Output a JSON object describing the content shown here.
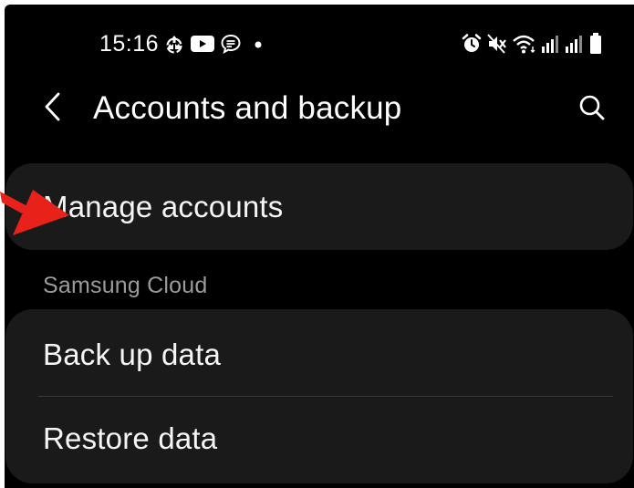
{
  "status_bar": {
    "time": "15:16",
    "left_icons": [
      "sync-icon",
      "youtube-icon",
      "message-icon",
      "dot-icon"
    ],
    "right_icons": [
      "alarm-icon",
      "mute-icon",
      "wifi-icon",
      "signal-icon",
      "signal-icon",
      "battery-icon"
    ]
  },
  "header": {
    "title": "Accounts and backup",
    "back_icon": "chevron-left-icon",
    "search_icon": "search-icon"
  },
  "sections": {
    "accounts": {
      "items": [
        {
          "label": "Manage accounts"
        }
      ]
    },
    "cloud": {
      "header": "Samsung Cloud",
      "items": [
        {
          "label": "Back up data"
        },
        {
          "label": "Restore data"
        }
      ]
    }
  },
  "annotation": {
    "type": "red-arrow",
    "color": "#e8221b",
    "points_to": "Manage accounts"
  },
  "colors": {
    "background": "#000000",
    "card": "#1a1a1a",
    "text": "#f5f5f5",
    "section_header": "#9b9b9b",
    "annotation": "#e8221b"
  }
}
